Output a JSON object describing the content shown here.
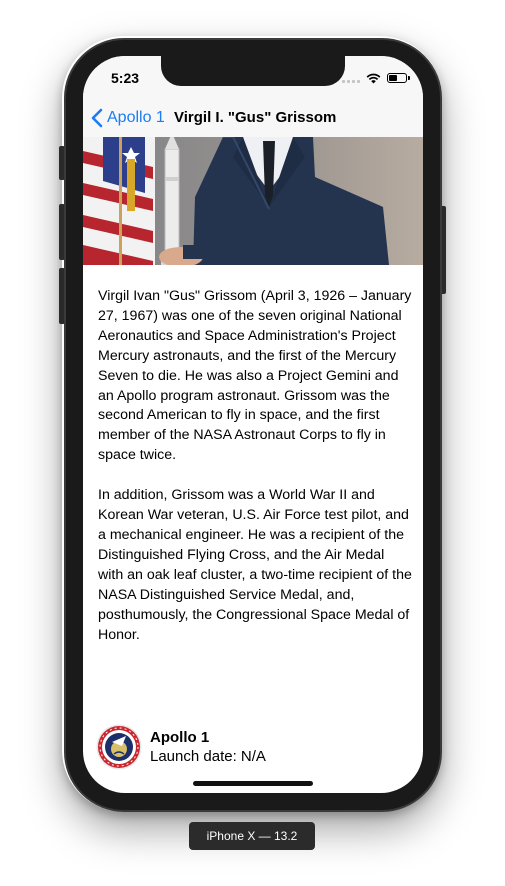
{
  "status_bar": {
    "time": "5:23",
    "battery_level": 0.55
  },
  "nav": {
    "back_label": "Apollo 1",
    "title": "Virgil I. \"Gus\" Grissom"
  },
  "bio": {
    "paragraphs": [
      "Virgil Ivan \"Gus\" Grissom (April 3, 1926 – January 27, 1967) was one of the seven original National Aeronautics and Space Administration's Project Mercury astronauts, and the first of the Mercury Seven to die. He was also a Project Gemini and an Apollo program astronaut. Grissom was the second American to fly in space, and the first member of the NASA Astronaut Corps to fly in space twice.",
      "In addition, Grissom was a World War II and Korean War veteran, U.S. Air Force test pilot, and a mechanical engineer. He was a recipient of the Distinguished Flying Cross, and the Air Medal with an oak leaf cluster, a two-time recipient of the NASA Distinguished Service Medal, and, posthumously, the Congressional Space Medal of Honor."
    ]
  },
  "mission": {
    "name": "Apollo 1",
    "launch_label": "Launch date:",
    "launch_value": "N/A"
  },
  "device_label": "iPhone X — 13.2",
  "colors": {
    "link": "#1b7cf4",
    "nav_bg": "#f7f7f7",
    "frame": "#1a1a1a"
  },
  "icons": [
    "chevron-left-icon",
    "signal-icon",
    "wifi-icon",
    "battery-icon",
    "mission-patch-icon"
  ]
}
